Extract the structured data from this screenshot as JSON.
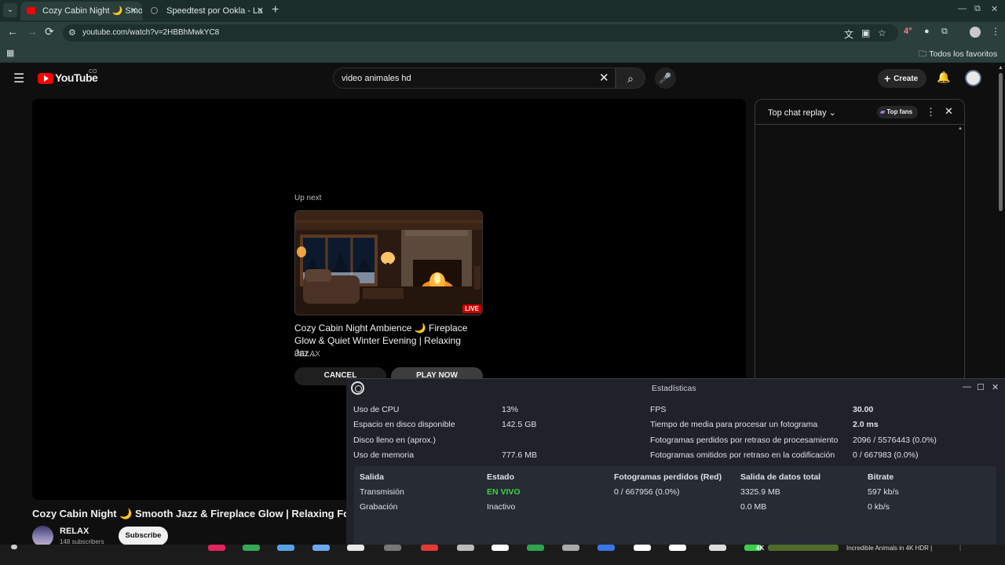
{
  "browser": {
    "tabs": [
      {
        "title": "Cozy Cabin Night 🌙 Smo",
        "favicon_color": "#ff0000",
        "close": "✕"
      },
      {
        "title": "Speedtest por Ookla - La",
        "favicon_color": "#888888",
        "close": "✕"
      }
    ],
    "new_tab": "+",
    "window_controls": {
      "minimize": "—",
      "restore": "⧉",
      "close": "✕"
    },
    "nav": {
      "back": "←",
      "forward": "→",
      "reload": "⟳"
    },
    "url": "youtube.com/watch?v=2HBBhMwkYC8",
    "extension_badge": "4°",
    "bookmarks_folder": "Todos los favoritos"
  },
  "youtube": {
    "logo_text": "YouTube",
    "country_code": "CO",
    "search_value": "video animales hd",
    "create_label": "Create",
    "player": {
      "up_next_label": "Up next",
      "live_label": "LIVE",
      "next_title": "Cozy Cabin Night Ambience 🌙 Fireplace Glow & Quiet Winter Evening | Relaxing Jaz...",
      "next_channel": "RELAX",
      "cancel_label": "CANCEL",
      "play_now_label": "PLAY NOW"
    },
    "video_title": "Cozy Cabin Night 🌙 Smooth Jazz & Fireplace Glow | Relaxing Fore",
    "channel": {
      "name": "RELAX",
      "subscribers": "148 subscribers",
      "subscribe_label": "Subscribe"
    },
    "chat": {
      "title": "Top chat replay",
      "top_fans_label": "Top fans"
    }
  },
  "obs_stats": {
    "window_title": "Estadísticas",
    "left_metrics": [
      {
        "label": "Uso de CPU",
        "value": "13%"
      },
      {
        "label": "Espacio en disco disponible",
        "value": "142.5 GB"
      },
      {
        "label": "Disco lleno en (aprox.)",
        "value": ""
      },
      {
        "label": "Uso de memoria",
        "value": "777.6 MB"
      }
    ],
    "right_metrics": [
      {
        "label": "FPS",
        "value": "30.00"
      },
      {
        "label": "Tiempo de media para procesar un fotograma",
        "value": "2.0 ms"
      },
      {
        "label": "Fotogramas perdidos por retraso de procesamiento",
        "value": "2096 / 5576443 (0.0%)"
      },
      {
        "label": "Fotogramas omitidos por retraso en la codificación",
        "value": "0 / 667983 (0.0%)"
      }
    ],
    "output_table": {
      "headers": [
        "Salida",
        "Estado",
        "Fotogramas perdidos (Red)",
        "Salida de datos total",
        "Bitrate"
      ],
      "rows": [
        [
          "Transmisión",
          "EN VIVO",
          "0 / 667956 (0.0%)",
          "3325.9 MB",
          "597 kb/s"
        ],
        [
          "Grabación",
          "Inactivo",
          "",
          "0.0 MB",
          "0 kb/s"
        ]
      ]
    },
    "live_color": "#3bd63b"
  },
  "taskbar": {
    "notification_text": "Incredible Animals in 4K HDR |",
    "thumb_badge": "4K"
  }
}
